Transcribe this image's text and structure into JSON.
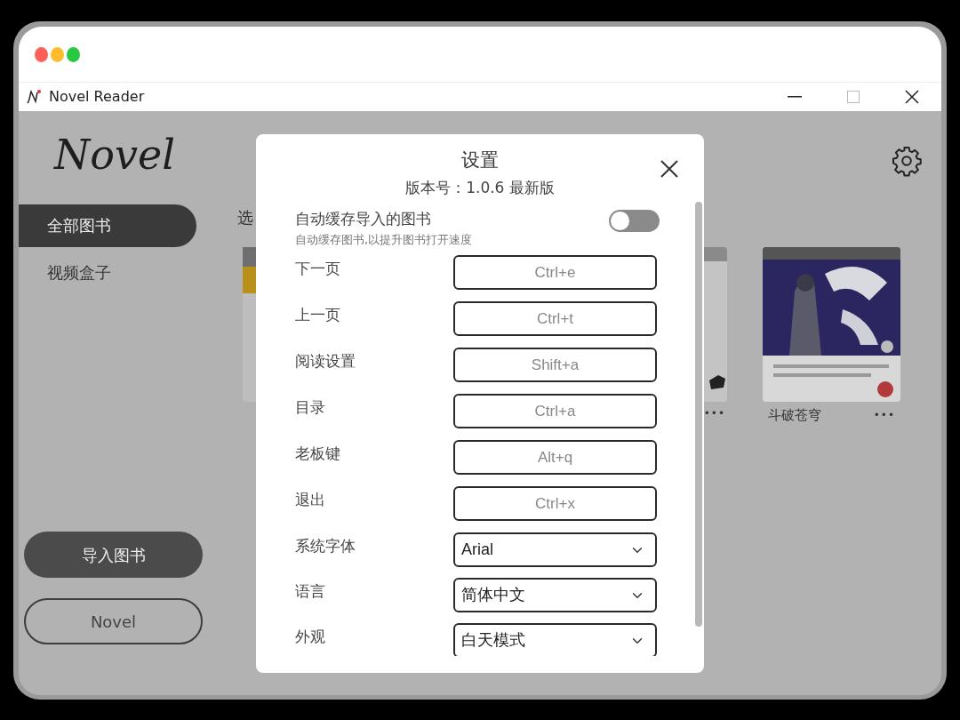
{
  "window": {
    "title": "Novel Reader"
  },
  "sidebar": {
    "logo": "Novel",
    "items": [
      {
        "label": "全部图书",
        "selected": true
      },
      {
        "label": "视频盒子",
        "selected": false
      }
    ],
    "buttons": [
      {
        "label": "导入图书",
        "kind": "filled"
      },
      {
        "label": "Novel",
        "kind": "outline"
      }
    ]
  },
  "library": {
    "heading": "选",
    "books": [
      {
        "kind": "edge",
        "more": "•••"
      },
      {
        "kind": "full",
        "title": "斗破苍穹",
        "more": "•••"
      }
    ]
  },
  "settings": {
    "title": "设置",
    "version": "版本号：1.0.6  最新版",
    "auto_cache": {
      "label": "自动缓存导入的图书",
      "hint": "自动缓存图书,以提升图书打开速度",
      "on": false
    },
    "shortcuts": [
      {
        "label": "下一页",
        "placeholder": "Ctrl+e"
      },
      {
        "label": "上一页",
        "placeholder": "Ctrl+t"
      },
      {
        "label": "阅读设置",
        "placeholder": "Shift+a"
      },
      {
        "label": "目录",
        "placeholder": "Ctrl+a"
      },
      {
        "label": "老板键",
        "placeholder": "Alt+q"
      },
      {
        "label": "退出",
        "placeholder": "Ctrl+x"
      }
    ],
    "selects": [
      {
        "label": "系统字体",
        "value": "Arial"
      },
      {
        "label": "语言",
        "value": "简体中文"
      },
      {
        "label": "外观",
        "value": "白天模式"
      }
    ]
  }
}
